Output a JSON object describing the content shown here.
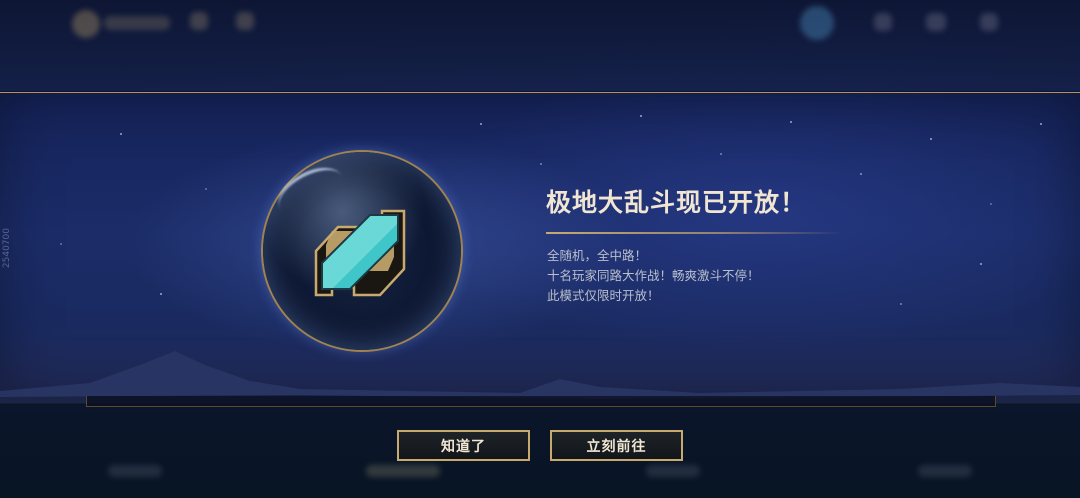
{
  "modal": {
    "title": "极地大乱斗现已开放！",
    "description_lines": [
      "全随机，全中路！",
      "十名玩家同路大作战！畅爽激斗不停！",
      "此模式仅限时开放！"
    ],
    "emblem_icon": "aram-mode-emblem-icon"
  },
  "buttons": {
    "acknowledge_label": "知道了",
    "go_now_label": "立刻前往"
  },
  "colors": {
    "gold": "#c8aa6e",
    "title_text": "#f0e6d2",
    "body_text": "#b9bfcc",
    "emblem_teal": "#3fc6c8"
  }
}
